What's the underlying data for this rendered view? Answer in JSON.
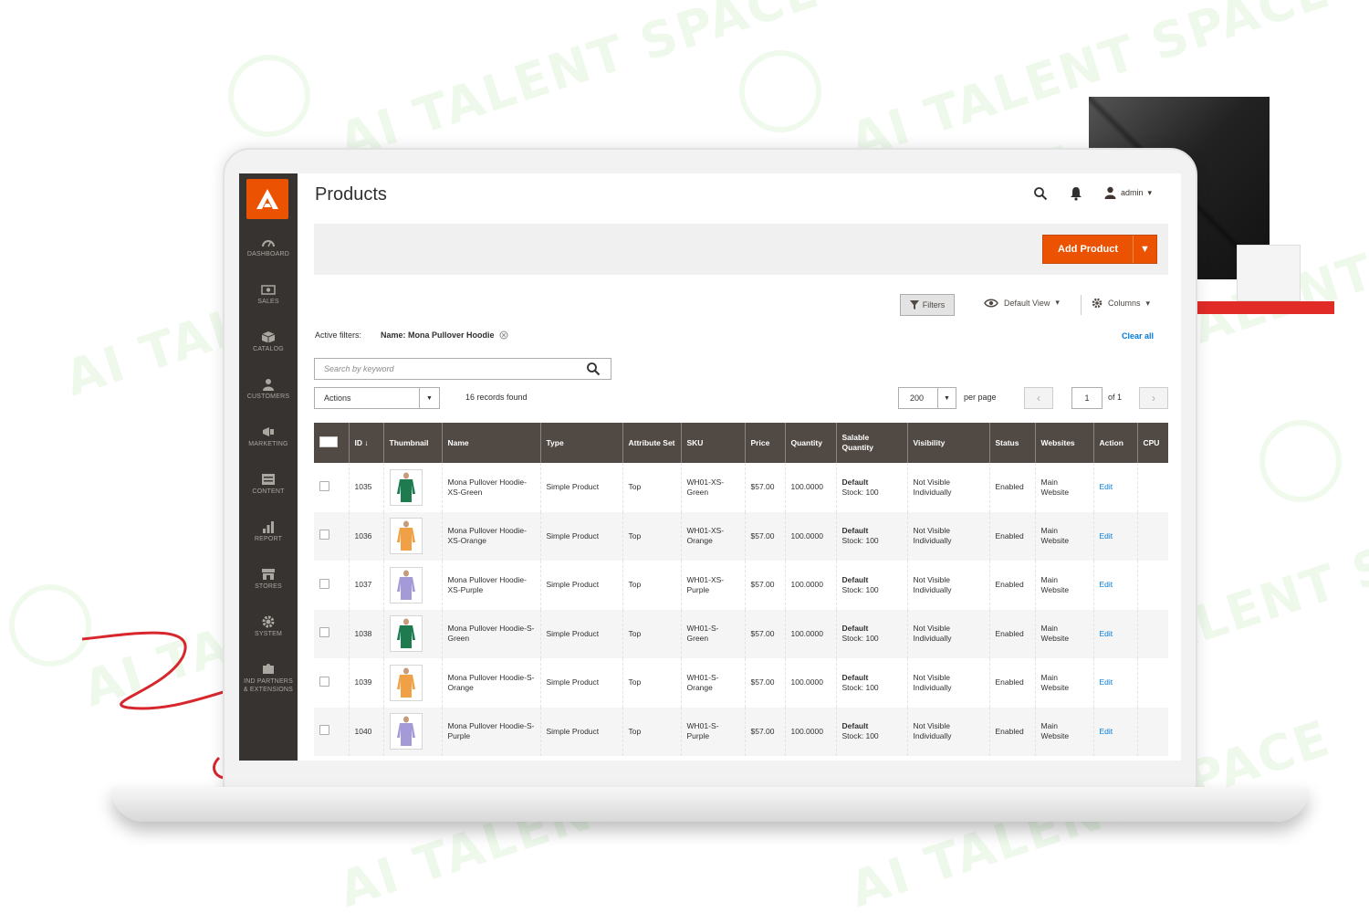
{
  "watermark": {
    "text": "AI TALENT SPACE"
  },
  "sidebar": {
    "items": [
      {
        "label": "DASHBOARD",
        "icon": "dashboard-icon"
      },
      {
        "label": "SALES",
        "icon": "dollar-icon"
      },
      {
        "label": "CATALOG",
        "icon": "cube-icon"
      },
      {
        "label": "CUSTOMERS",
        "icon": "person-icon"
      },
      {
        "label": "MARKETING",
        "icon": "megaphone-icon"
      },
      {
        "label": "CONTENT",
        "icon": "layout-icon"
      },
      {
        "label": "REPORT",
        "icon": "bar-chart-icon"
      },
      {
        "label": "STORES",
        "icon": "store-icon"
      },
      {
        "label": "SYSTEM",
        "icon": "gear-icon"
      },
      {
        "label": "IND PARTNERS\n& EXTENSIONS",
        "icon": "puzzle-icon"
      }
    ]
  },
  "header": {
    "title": "Products",
    "user": "admin"
  },
  "toolbar": {
    "add_product": "Add Product",
    "filters": "Filters",
    "default_view": "Default View",
    "columns": "Columns",
    "active_filters_label": "Active filters:",
    "active_filter": "Name: Mona Pullover Hoodie",
    "clear_all": "Clear all",
    "search_placeholder": "Search by keyword",
    "actions": "Actions",
    "records_found": "16 records found",
    "per_page_value": "200",
    "per_page_label": "per page",
    "page_current": "1",
    "page_of": "of 1"
  },
  "grid": {
    "columns": [
      "ID",
      "Thumbnail",
      "Name",
      "Type",
      "Attribute Set",
      "SKU",
      "Price",
      "Quantity",
      "Salable Quantity",
      "Visibility",
      "Status",
      "Websites",
      "Action",
      "CPU"
    ],
    "rows": [
      {
        "id": "1035",
        "color": "#1e7a4f",
        "name": "Mona Pullover Hoodie-XS-Green",
        "type": "Simple Product",
        "attr": "Top",
        "sku": "WH01-XS-Green",
        "price": "$57.00",
        "qty": "100.0000",
        "salable_bold": "Default",
        "salable": "Stock: 100",
        "visibility": "Not Visible Individually",
        "status": "Enabled",
        "websites": "Main Website",
        "action": "Edit"
      },
      {
        "id": "1036",
        "color": "#f0a045",
        "name": "Mona Pullover Hoodie-XS-Orange",
        "type": "Simple Product",
        "attr": "Top",
        "sku": "WH01-XS-Orange",
        "price": "$57.00",
        "qty": "100.0000",
        "salable_bold": "Default",
        "salable": "Stock: 100",
        "visibility": "Not Visible Individually",
        "status": "Enabled",
        "websites": "Main Website",
        "action": "Edit"
      },
      {
        "id": "1037",
        "color": "#a59ad8",
        "name": "Mona Pullover Hoodie-XS-Purple",
        "type": "Simple Product",
        "attr": "Top",
        "sku": "WH01-XS-Purple",
        "price": "$57.00",
        "qty": "100.0000",
        "salable_bold": "Default",
        "salable": "Stock: 100",
        "visibility": "Not Visible Individually",
        "status": "Enabled",
        "websites": "Main Website",
        "action": "Edit"
      },
      {
        "id": "1038",
        "color": "#1e7a4f",
        "name": "Mona Pullover Hoodie-S-Green",
        "type": "Simple Product",
        "attr": "Top",
        "sku": "WH01-S-Green",
        "price": "$57.00",
        "qty": "100.0000",
        "salable_bold": "Default",
        "salable": "Stock: 100",
        "visibility": "Not Visible Individually",
        "status": "Enabled",
        "websites": "Main Website",
        "action": "Edit"
      },
      {
        "id": "1039",
        "color": "#f0a045",
        "name": "Mona Pullover Hoodie-S-Orange",
        "type": "Simple Product",
        "attr": "Top",
        "sku": "WH01-S-Orange",
        "price": "$57.00",
        "qty": "100.0000",
        "salable_bold": "Default",
        "salable": "Stock: 100",
        "visibility": "Not Visible Individually",
        "status": "Enabled",
        "websites": "Main Website",
        "action": "Edit"
      },
      {
        "id": "1040",
        "color": "#a59ad8",
        "name": "Mona Pullover Hoodie-S-Purple",
        "type": "Simple Product",
        "attr": "Top",
        "sku": "WH01-S-Purple",
        "price": "$57.00",
        "qty": "100.0000",
        "salable_bold": "Default",
        "salable": "Stock: 100",
        "visibility": "Not Visible Individually",
        "status": "Enabled",
        "websites": "Main Website",
        "action": "Edit"
      }
    ]
  },
  "colors": {
    "accent": "#eb5202",
    "sidebar": "#373330",
    "grid_header": "#514943",
    "link": "#007bdb"
  }
}
